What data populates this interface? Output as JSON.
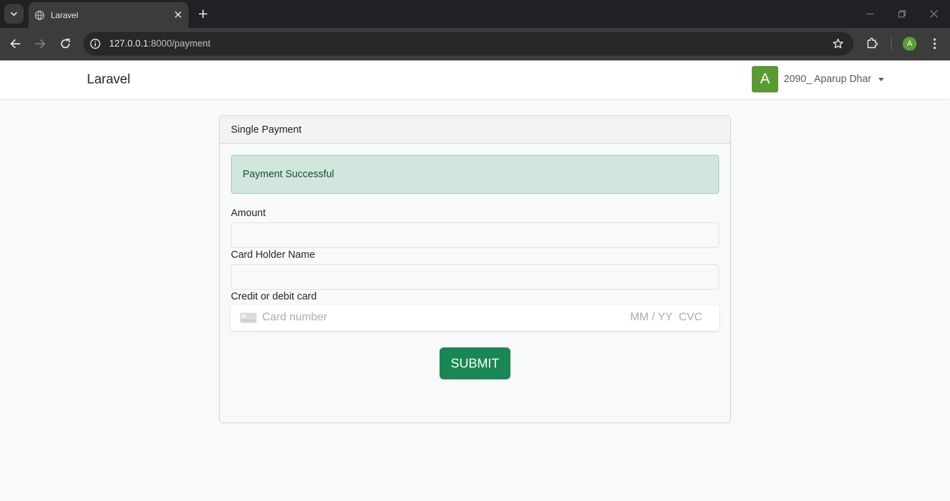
{
  "browser": {
    "tab_title": "Laravel",
    "url_host": "127.0.0.1",
    "url_path": ":8000/payment",
    "profile_initial": "A"
  },
  "nav": {
    "brand": "Laravel",
    "user_initial": "A",
    "user_name": "2090_ Aparup Dhar"
  },
  "card": {
    "header": "Single Payment",
    "alert": "Payment Successful",
    "amount_label": "Amount",
    "amount_value": "",
    "holder_label": "Card Holder Name",
    "holder_value": "",
    "card_label": "Credit or debit card",
    "card_number_placeholder": "Card number",
    "expiry_placeholder": "MM / YY",
    "cvc_placeholder": "CVC",
    "submit_label": "SUBMIT"
  },
  "colors": {
    "success_button": "#198754",
    "alert_background": "#d1e7dd",
    "avatar": "#5a9a32"
  }
}
